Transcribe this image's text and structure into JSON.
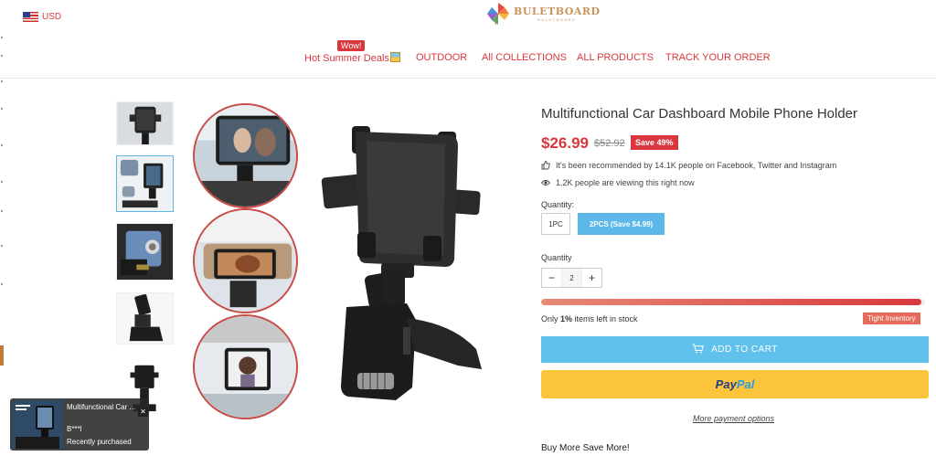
{
  "header": {
    "currency": "USD",
    "logo_main": "BULETBOARD",
    "logo_sub": "BULETBOARD",
    "wow_badge": "Wow!",
    "nav": [
      {
        "label": "Hot Summer Deals"
      },
      {
        "label": "OUTDOOR"
      },
      {
        "label": "All COLLECTIONS"
      },
      {
        "label": "ALL PRODUCTS"
      },
      {
        "label": "TRACK YOUR ORDER"
      }
    ]
  },
  "gallery": {
    "thumbnails": [
      "phone-holder-front",
      "phone-holder-installed",
      "phone-holder-clip-detail",
      "phone-holder-side",
      "phone-holder-mounted"
    ],
    "active_thumbnail": 1
  },
  "product": {
    "title": "Multifunctional Car Dashboard Mobile Phone Holder",
    "price": "$26.99",
    "old_price": "$52.92",
    "save_badge": "Save 49%",
    "recommend_text": "It's been recommended by 14.1K people on Facebook, Twitter and Instagram",
    "viewing_text": "1.2K people are viewing this right now",
    "quantity_label_1": "Quantity:",
    "options": [
      "1PC",
      "2PCS  (Save $4.99)"
    ],
    "selected_option": 1,
    "quantity_label_2": "Quantity",
    "quantity_value": "2",
    "stock_fraction": 0.99,
    "stock_prefix": "Only ",
    "stock_percent": "1%",
    "stock_suffix": " items left in stock",
    "tight_label": "Tight Inventory",
    "add_to_cart": "ADD TO CART",
    "paypal_a": "Pay",
    "paypal_b": "Pal",
    "more_payment": "More payment options",
    "buy_more": "Buy More Save More!"
  },
  "popup": {
    "title": "Multifunctional Car ...",
    "name": "B***l",
    "status": "Recently purchased",
    "close": "✕"
  },
  "colors": {
    "accent_red": "#d8383d",
    "cart_blue": "#5fc1ec",
    "paypal_yellow": "#fbc43a",
    "logo_gold": "#c8945b"
  }
}
